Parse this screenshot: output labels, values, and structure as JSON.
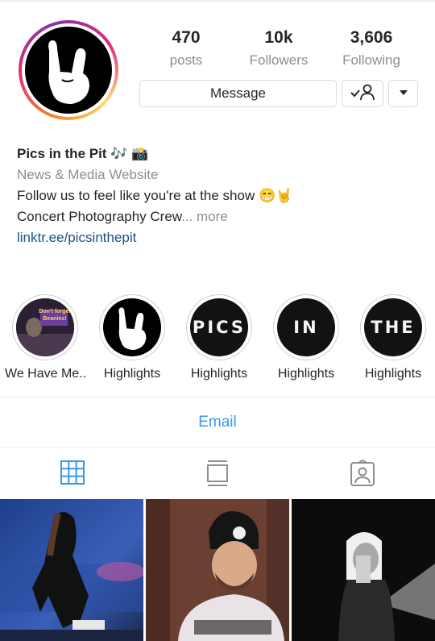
{
  "profile": {
    "stats": [
      {
        "value": "470",
        "label": "posts"
      },
      {
        "value": "10k",
        "label": "Followers"
      },
      {
        "value": "3,606",
        "label": "Following"
      }
    ],
    "name": "Pics in the Pit 🎶 📸",
    "category": "News & Media Website",
    "bio_line1": "Follow us to feel like you're at the show 😁🤘",
    "bio_line2": "Concert Photography Crew",
    "bio_ellipsis": "... more",
    "link": "linktr.ee/picsinthepit"
  },
  "buttons": {
    "message": "Message"
  },
  "highlights": [
    {
      "caption": "We Have Me...",
      "cover_text": "Don't forget Beanies!"
    },
    {
      "caption": "Highlights",
      "cover_text": ""
    },
    {
      "caption": "Highlights",
      "cover_text": "PICS"
    },
    {
      "caption": "Highlights",
      "cover_text": "IN"
    },
    {
      "caption": "Highlights",
      "cover_text": "THE"
    }
  ],
  "contact": {
    "email_label": "Email"
  },
  "tabs": [
    {
      "icon": "grid-icon",
      "active": true
    },
    {
      "icon": "feed-icon",
      "active": false
    },
    {
      "icon": "tagged-icon",
      "active": false
    }
  ],
  "colors": {
    "accent_blue": "#3897f0",
    "link_blue": "#1d4e89",
    "muted": "#8e8e8e",
    "text": "#262626"
  }
}
